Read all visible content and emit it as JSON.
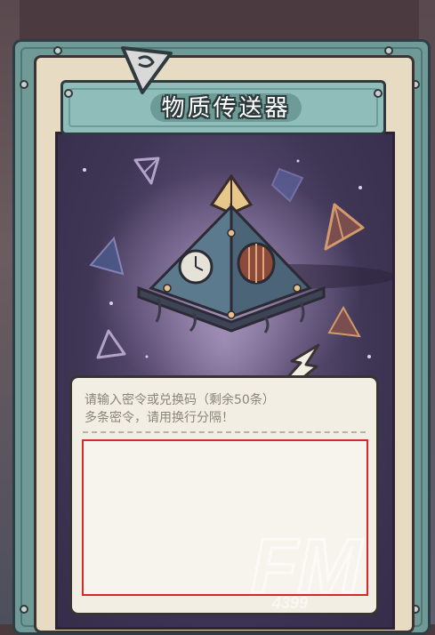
{
  "dialog": {
    "title": "物质传送器",
    "hint_line1": "请输入密令或兑换码（剩余50条）",
    "hint_line2": "多条密令，请用换行分隔！",
    "input_value": ""
  },
  "watermark": {
    "text": "FM",
    "sub": "4399"
  },
  "colors": {
    "frame_teal": "#6f9a98",
    "frame_cream": "#e7dcc3",
    "content_purple": "#3f3656",
    "input_highlight": "#d42a2a"
  },
  "icons": [
    "back-arrow-icon",
    "pyramid-teleporter-icon",
    "crystal-icon"
  ]
}
